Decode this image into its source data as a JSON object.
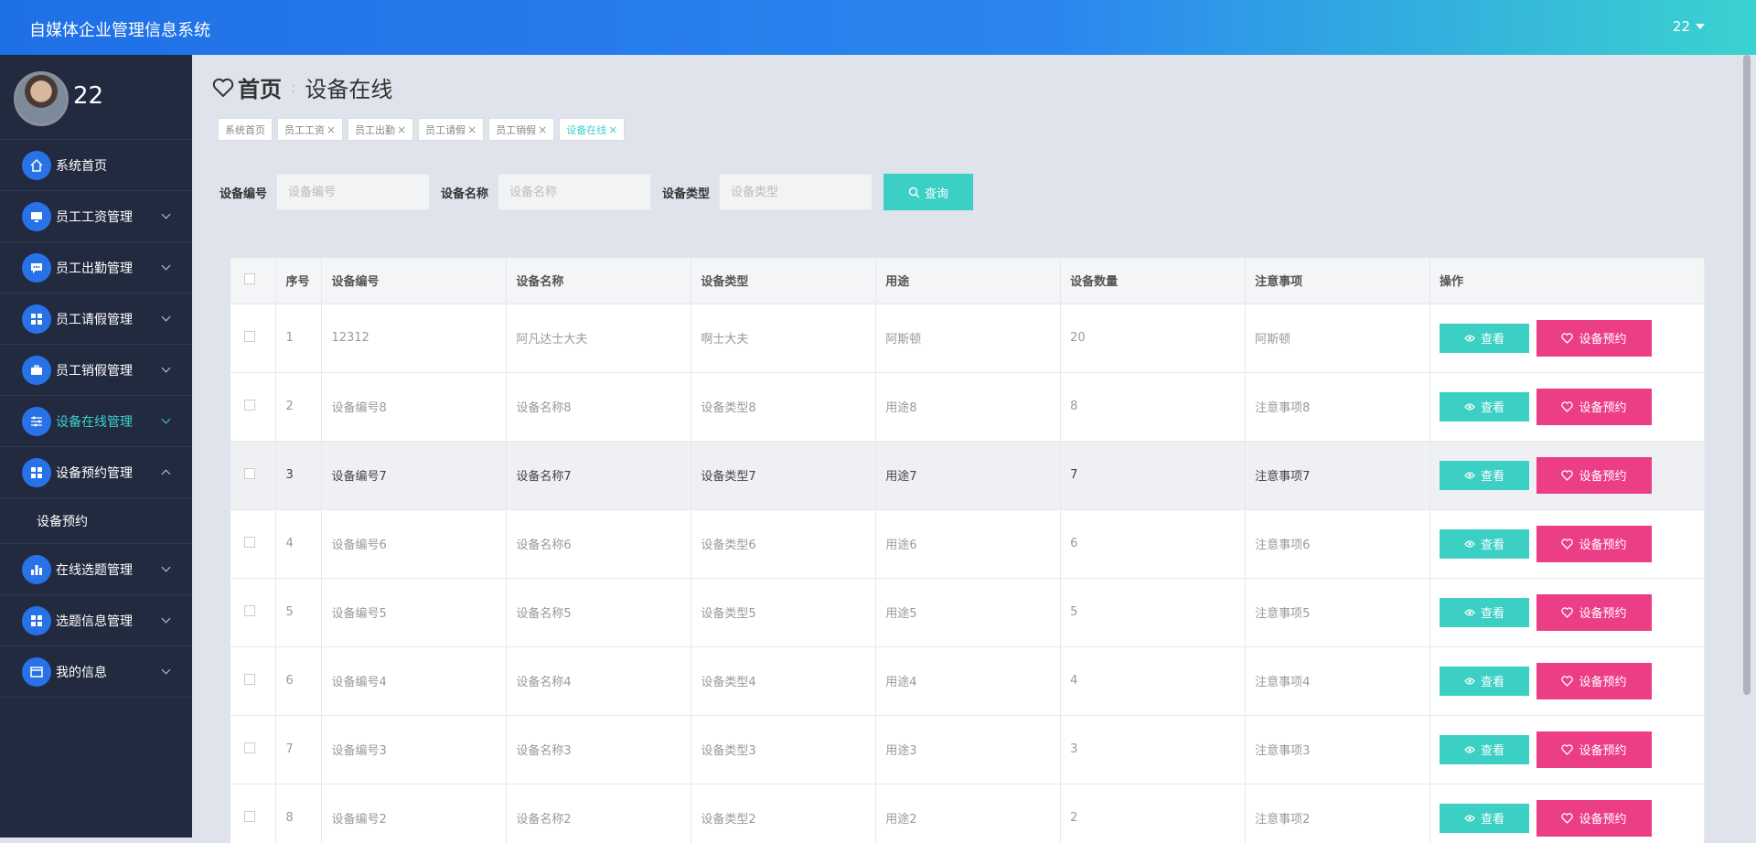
{
  "app": {
    "title": "自媒体企业管理信息系统",
    "user": "22"
  },
  "profile": {
    "name": "22"
  },
  "sidebar": {
    "items": [
      {
        "label": "系统首页",
        "icon": "home-icon"
      },
      {
        "label": "员工工资管理",
        "icon": "monitor-icon"
      },
      {
        "label": "员工出勤管理",
        "icon": "chat-icon"
      },
      {
        "label": "员工请假管理",
        "icon": "grid-icon"
      },
      {
        "label": "员工销假管理",
        "icon": "briefcase-icon"
      },
      {
        "label": "设备在线管理",
        "icon": "sliders-icon"
      },
      {
        "label": "设备预约管理",
        "icon": "grid-icon"
      },
      {
        "label": "在线选题管理",
        "icon": "bar-chart-icon"
      },
      {
        "label": "选题信息管理",
        "icon": "grid-icon"
      },
      {
        "label": "我的信息",
        "icon": "card-icon"
      }
    ],
    "submenu": {
      "label": "设备预约"
    }
  },
  "breadcrumb": {
    "home": "首页",
    "current": "设备在线"
  },
  "tabs": [
    "系统首页",
    "员工工资",
    "员工出勤",
    "员工请假",
    "员工销假",
    "设备在线"
  ],
  "search": {
    "code_label": "设备编号",
    "code_placeholder": "设备编号",
    "name_label": "设备名称",
    "name_placeholder": "设备名称",
    "type_label": "设备类型",
    "type_placeholder": "设备类型",
    "button": "查询"
  },
  "table": {
    "headers": [
      "序号",
      "设备编号",
      "设备名称",
      "设备类型",
      "用途",
      "设备数量",
      "注意事项",
      "操作"
    ],
    "rows": [
      [
        "1",
        "12312",
        "阿凡达士大夫",
        "啊士大夫",
        "阿斯顿",
        "20",
        "阿斯顿"
      ],
      [
        "2",
        "设备编号8",
        "设备名称8",
        "设备类型8",
        "用途8",
        "8",
        "注意事项8"
      ],
      [
        "3",
        "设备编号7",
        "设备名称7",
        "设备类型7",
        "用途7",
        "7",
        "注意事项7"
      ],
      [
        "4",
        "设备编号6",
        "设备名称6",
        "设备类型6",
        "用途6",
        "6",
        "注意事项6"
      ],
      [
        "5",
        "设备编号5",
        "设备名称5",
        "设备类型5",
        "用途5",
        "5",
        "注意事项5"
      ],
      [
        "6",
        "设备编号4",
        "设备名称4",
        "设备类型4",
        "用途4",
        "4",
        "注意事项4"
      ],
      [
        "7",
        "设备编号3",
        "设备名称3",
        "设备类型3",
        "用途3",
        "3",
        "注意事项3"
      ],
      [
        "8",
        "设备编号2",
        "设备名称2",
        "设备类型2",
        "用途2",
        "2",
        "注意事项2"
      ]
    ],
    "view_label": "查看",
    "book_label": "设备预约"
  },
  "colors": {
    "accent": "#3ccfc4",
    "pink": "#ec3e87",
    "sidebar": "#222a40",
    "brand_blue": "#2872e8"
  }
}
